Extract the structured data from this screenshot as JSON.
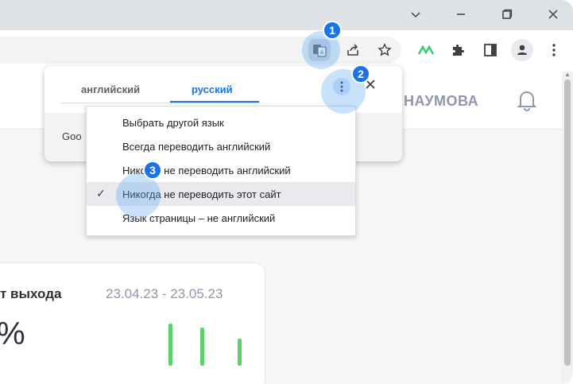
{
  "window": {
    "controls": [
      "chevron-down",
      "minimize",
      "maximize",
      "close"
    ]
  },
  "toolbar": {
    "icons": [
      "translate-icon",
      "share-icon",
      "star-icon",
      "extension-logo-icon",
      "puzzle-icon",
      "sidepanel-icon",
      "profile-icon",
      "more-vert-icon"
    ]
  },
  "page": {
    "user_name": "НАУМОВА",
    "card": {
      "title": "т выхода",
      "date_range": "23.04.23 - 23.05.23",
      "big_value": "%",
      "bar_levels": [
        0.85,
        0.78,
        0.55
      ],
      "bar_color": "#5bd26a"
    }
  },
  "translate_popup": {
    "tab_source": "английский",
    "tab_target": "русский",
    "footer_text": "Goo",
    "accent": "#1a73e8"
  },
  "menu": {
    "items": [
      {
        "label": "Выбрать другой язык",
        "checked": false
      },
      {
        "label": "Всегда переводить английский",
        "checked": false
      },
      {
        "label": "Никогда не переводить английский",
        "checked": false
      },
      {
        "label": "Никогда не переводить этот сайт",
        "checked": true
      },
      {
        "label": "Язык страницы – не английский",
        "checked": false
      }
    ]
  },
  "callouts": [
    "1",
    "2",
    "3"
  ]
}
